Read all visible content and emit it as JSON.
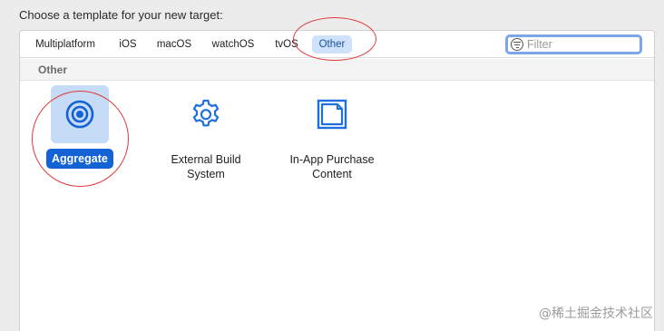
{
  "header": {
    "title": "Choose a template for your new target:"
  },
  "tabs": [
    {
      "label": "Multiplatform"
    },
    {
      "label": "iOS"
    },
    {
      "label": "macOS"
    },
    {
      "label": "watchOS"
    },
    {
      "label": "tvOS"
    },
    {
      "label": "Other",
      "active": true
    }
  ],
  "filter": {
    "placeholder": "Filter",
    "value": "",
    "icon": "filter-icon"
  },
  "section": {
    "title": "Other"
  },
  "templates": [
    {
      "label": "Aggregate",
      "icon": "aggregate-target-icon",
      "selected": true
    },
    {
      "label_line1": "External Build",
      "label_line2": "System",
      "icon": "gear-icon"
    },
    {
      "label_line1": "In-App Purchase",
      "label_line2": "Content",
      "icon": "in-app-purchase-icon"
    }
  ],
  "watermark": "@稀土掘金技术社区",
  "colors": {
    "accent": "#1463d6",
    "annotation": "#e03a3a",
    "active_tab_bg": "#cfe2fb"
  }
}
